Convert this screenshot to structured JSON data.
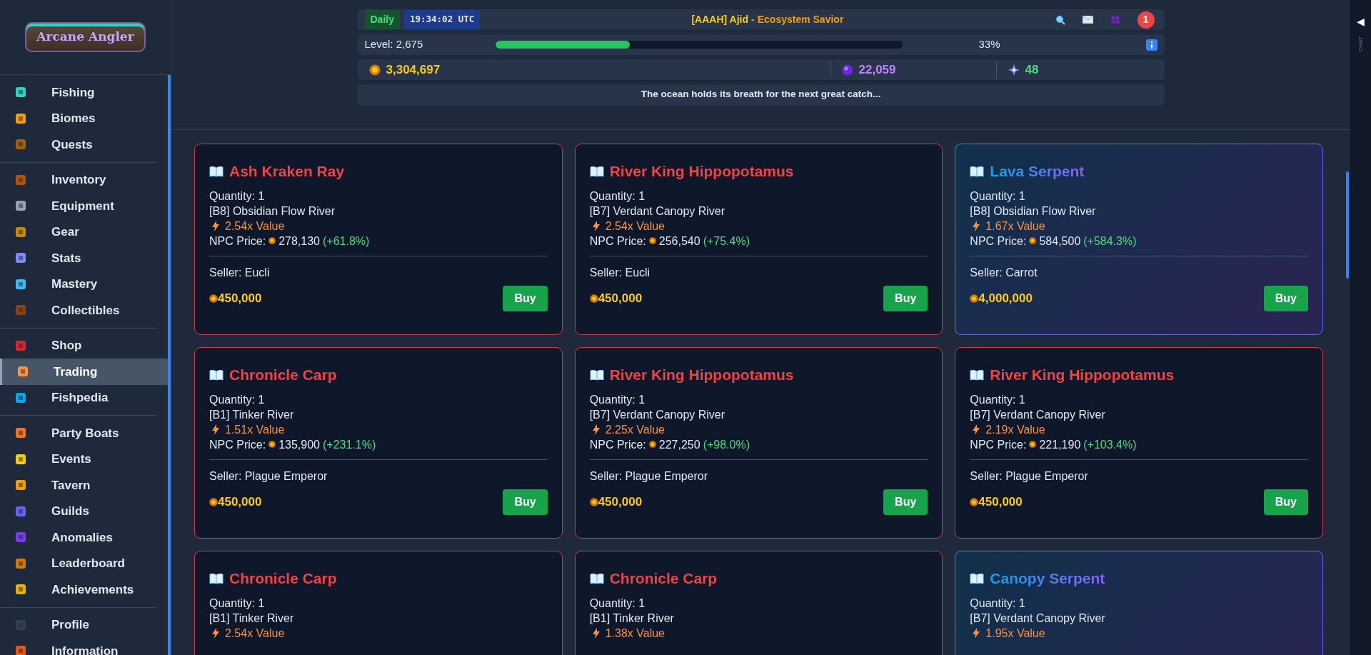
{
  "sidebar": {
    "logo": "Arcane Angler",
    "sections": [
      {
        "items": [
          {
            "label": "Fishing",
            "selected": false
          },
          {
            "label": "Biomes",
            "selected": false
          },
          {
            "label": "Quests",
            "selected": false
          }
        ]
      },
      {
        "items": [
          {
            "label": "Inventory",
            "selected": false
          },
          {
            "label": "Equipment",
            "selected": false
          },
          {
            "label": "Gear",
            "selected": false
          },
          {
            "label": "Stats",
            "selected": false
          },
          {
            "label": "Mastery",
            "selected": false
          },
          {
            "label": "Collectibles",
            "selected": false
          }
        ]
      },
      {
        "items": [
          {
            "label": "Shop",
            "selected": false
          },
          {
            "label": "Trading",
            "selected": true
          },
          {
            "label": "Fishpedia",
            "selected": false
          }
        ]
      },
      {
        "items": [
          {
            "label": "Party Boats",
            "selected": false
          },
          {
            "label": "Events",
            "selected": false
          },
          {
            "label": "Tavern",
            "selected": false
          },
          {
            "label": "Guilds",
            "selected": false
          },
          {
            "label": "Anomalies",
            "selected": false
          },
          {
            "label": "Leaderboard",
            "selected": false
          },
          {
            "label": "Achievements",
            "selected": false
          }
        ]
      },
      {
        "items": [
          {
            "label": "Profile",
            "selected": false
          },
          {
            "label": "Information",
            "selected": false
          }
        ]
      }
    ]
  },
  "header": {
    "daily": "Daily",
    "time": "19:34:02 UTC",
    "player": "[AAAH] Ajid",
    "separator": "-",
    "title": "Ecosystem Savior",
    "notifications": "1",
    "level_label": "Level: 2,675",
    "level": 0.33,
    "percent": "33%",
    "gold": "3,304,697",
    "orbs": "22,059",
    "gems": "48",
    "message": "The ocean holds its breath for the next great catch..."
  },
  "listings": [
    {
      "kind": "plain",
      "name": "Ash Kraken Ray",
      "quantity": "Quantity: 1",
      "biome": "[B8] Obsidian Flow River",
      "value": "2.54x Value",
      "npc_label": "NPC Price:",
      "npc_price": "278,130",
      "npc_change": "(+61.8%)",
      "seller": "Seller: Eucli",
      "price": "450,000",
      "button": "Buy"
    },
    {
      "kind": "plain",
      "name": "River King Hippopotamus",
      "quantity": "Quantity: 1",
      "biome": "[B7] Verdant Canopy River",
      "value": "2.54x Value",
      "npc_label": "NPC Price:",
      "npc_price": "256,540",
      "npc_change": "(+75.4%)",
      "seller": "Seller: Eucli",
      "price": "450,000",
      "button": "Buy"
    },
    {
      "kind": "glow",
      "name": "Lava Serpent",
      "quantity": "Quantity: 1",
      "biome": "[B8] Obsidian Flow River",
      "value": "1.67x Value",
      "npc_label": "NPC Price:",
      "npc_price": "584,500",
      "npc_change": "(+584.3%)",
      "seller": "Seller: Carrot",
      "price": "4,000,000",
      "button": "Buy"
    },
    {
      "kind": "plain",
      "name": "Chronicle Carp",
      "quantity": "Quantity: 1",
      "biome": "[B1] Tinker River",
      "value": "1.51x Value",
      "npc_label": "NPC Price:",
      "npc_price": "135,900",
      "npc_change": "(+231.1%)",
      "seller": "Seller: Plague Emperor",
      "price": "450,000",
      "button": "Buy"
    },
    {
      "kind": "plain",
      "name": "River King Hippopotamus",
      "quantity": "Quantity: 1",
      "biome": "[B7] Verdant Canopy River",
      "value": "2.25x Value",
      "npc_label": "NPC Price:",
      "npc_price": "227,250",
      "npc_change": "(+98.0%)",
      "seller": "Seller: Plague Emperor",
      "price": "450,000",
      "button": "Buy"
    },
    {
      "kind": "plain",
      "name": "River King Hippopotamus",
      "quantity": "Quantity: 1",
      "biome": "[B7] Verdant Canopy River",
      "value": "2.19x Value",
      "npc_label": "NPC Price:",
      "npc_price": "221,190",
      "npc_change": "(+103.4%)",
      "seller": "Seller: Plague Emperor",
      "price": "450,000",
      "button": "Buy"
    },
    {
      "kind": "plain",
      "name": "Chronicle Carp",
      "quantity": "Quantity: 1",
      "biome": "[B1] Tinker River",
      "value": "2.54x Value"
    },
    {
      "kind": "plain",
      "name": "Chronicle Carp",
      "quantity": "Quantity: 1",
      "biome": "[B1] Tinker River",
      "value": "1.38x Value"
    },
    {
      "kind": "glow",
      "name": "Canopy Serpent",
      "quantity": "Quantity: 1",
      "biome": "[B7] Verdant Canopy River",
      "value": "1.95x Value"
    }
  ],
  "chat": {
    "toggle": "◀",
    "label": "CHAT"
  }
}
